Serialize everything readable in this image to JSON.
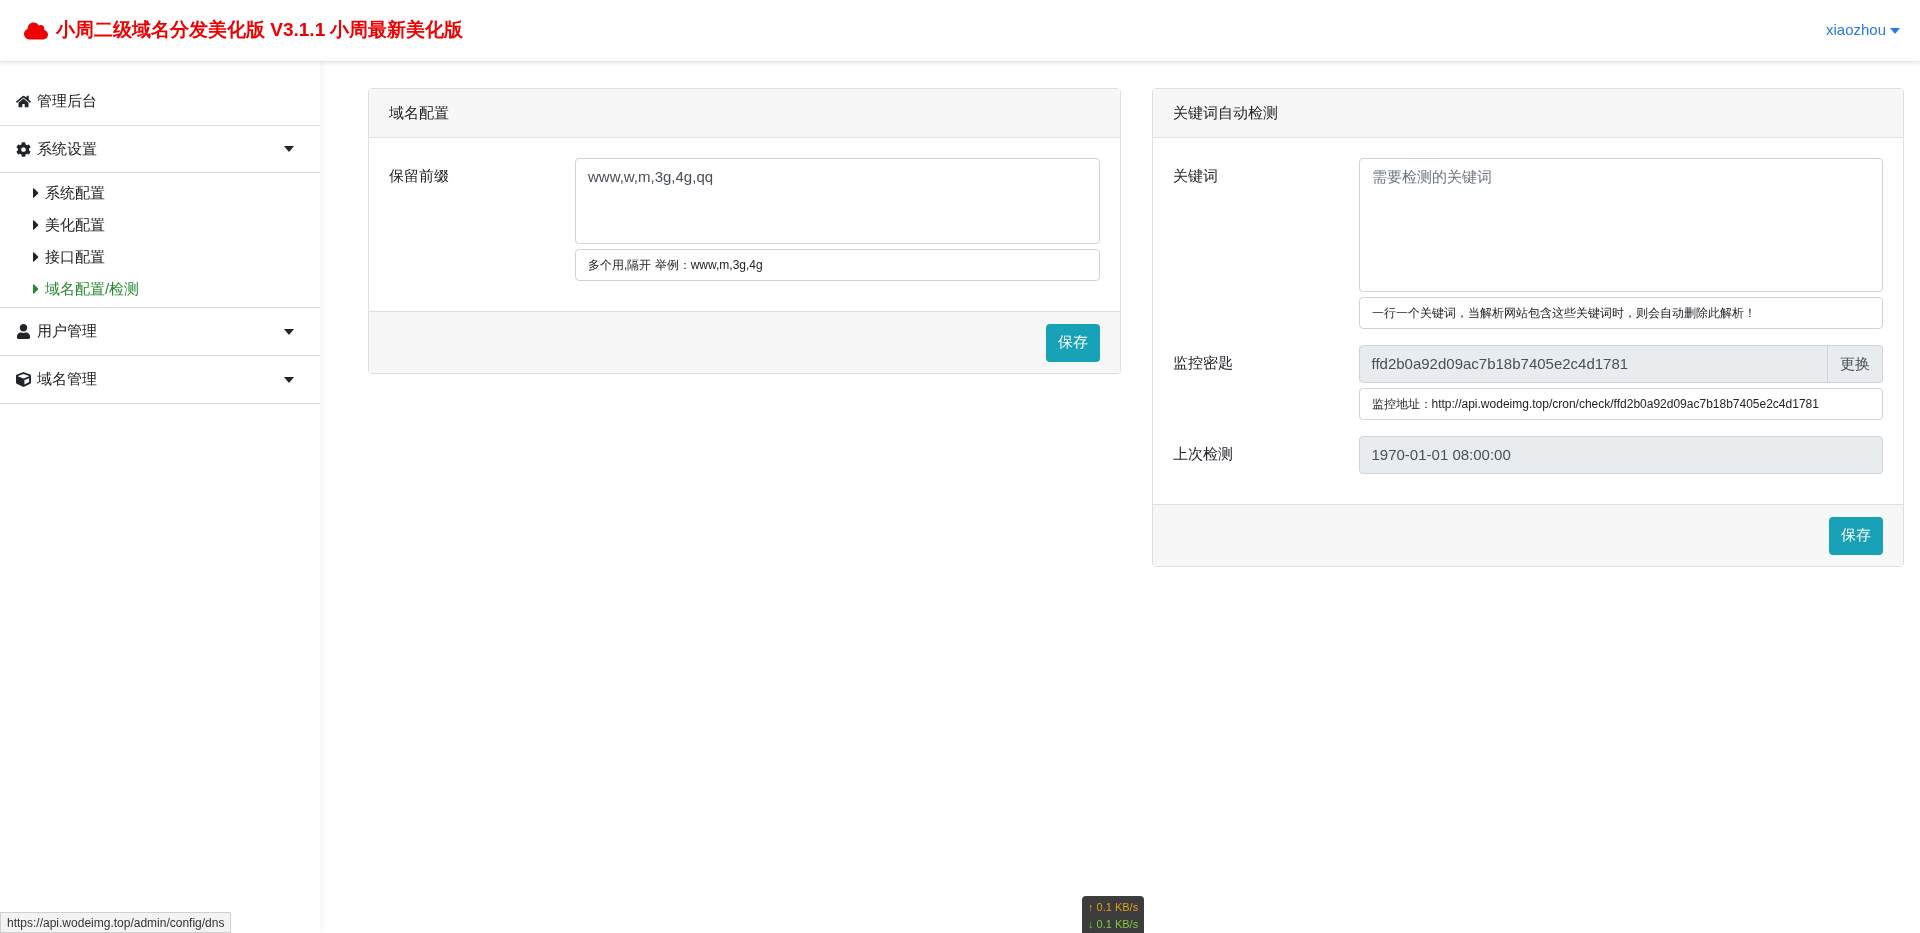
{
  "header": {
    "title": "小周二级域名分发美化版 V3.1.1 小周最新美化版",
    "user": "xiaozhou"
  },
  "sidebar": {
    "items": [
      {
        "kind": "link",
        "label": "管理后台"
      },
      {
        "kind": "group",
        "label": "系统设置",
        "expanded": true,
        "children": [
          {
            "label": "系统配置",
            "selected": false
          },
          {
            "label": "美化配置",
            "selected": false
          },
          {
            "label": "接口配置",
            "selected": false
          },
          {
            "label": "域名配置/检测",
            "selected": true
          }
        ]
      },
      {
        "kind": "group",
        "label": "用户管理"
      },
      {
        "kind": "group",
        "label": "域名管理"
      }
    ]
  },
  "cards": [
    {
      "title": "域名配置",
      "fields": [
        {
          "kind": "textarea",
          "label": "保留前缀",
          "value": "www,w,m,3g,4g,qq",
          "help": "多个用,隔开 举例：www,m,3g,4g"
        }
      ],
      "save": "保存"
    },
    {
      "title": "关键词自动检测",
      "fields": [
        {
          "kind": "textarea",
          "label": "关键词",
          "placeholder": "需要检测的关键词",
          "help": "一行一个关键词，当解析网站包含这些关键词时，则会自动删除此解析！"
        },
        {
          "kind": "input_group",
          "label": "监控密匙",
          "value": "ffd2b0a92d09ac7b18b7405e2c4d1781",
          "button": "更换",
          "help": "监控地址：http://api.wodeimg.top/cron/check/ffd2b0a92d09ac7b18b7405e2c4d1781"
        },
        {
          "kind": "readonly",
          "label": "上次检测",
          "value": "1970-01-01 08:00:00"
        }
      ],
      "save": "保存"
    }
  ],
  "status_url": "https://api.wodeimg.top/admin/config/dns",
  "net_speed": {
    "up": "↑ 0.1 KB/s",
    "down": "↓ 0.1 KB/s"
  }
}
